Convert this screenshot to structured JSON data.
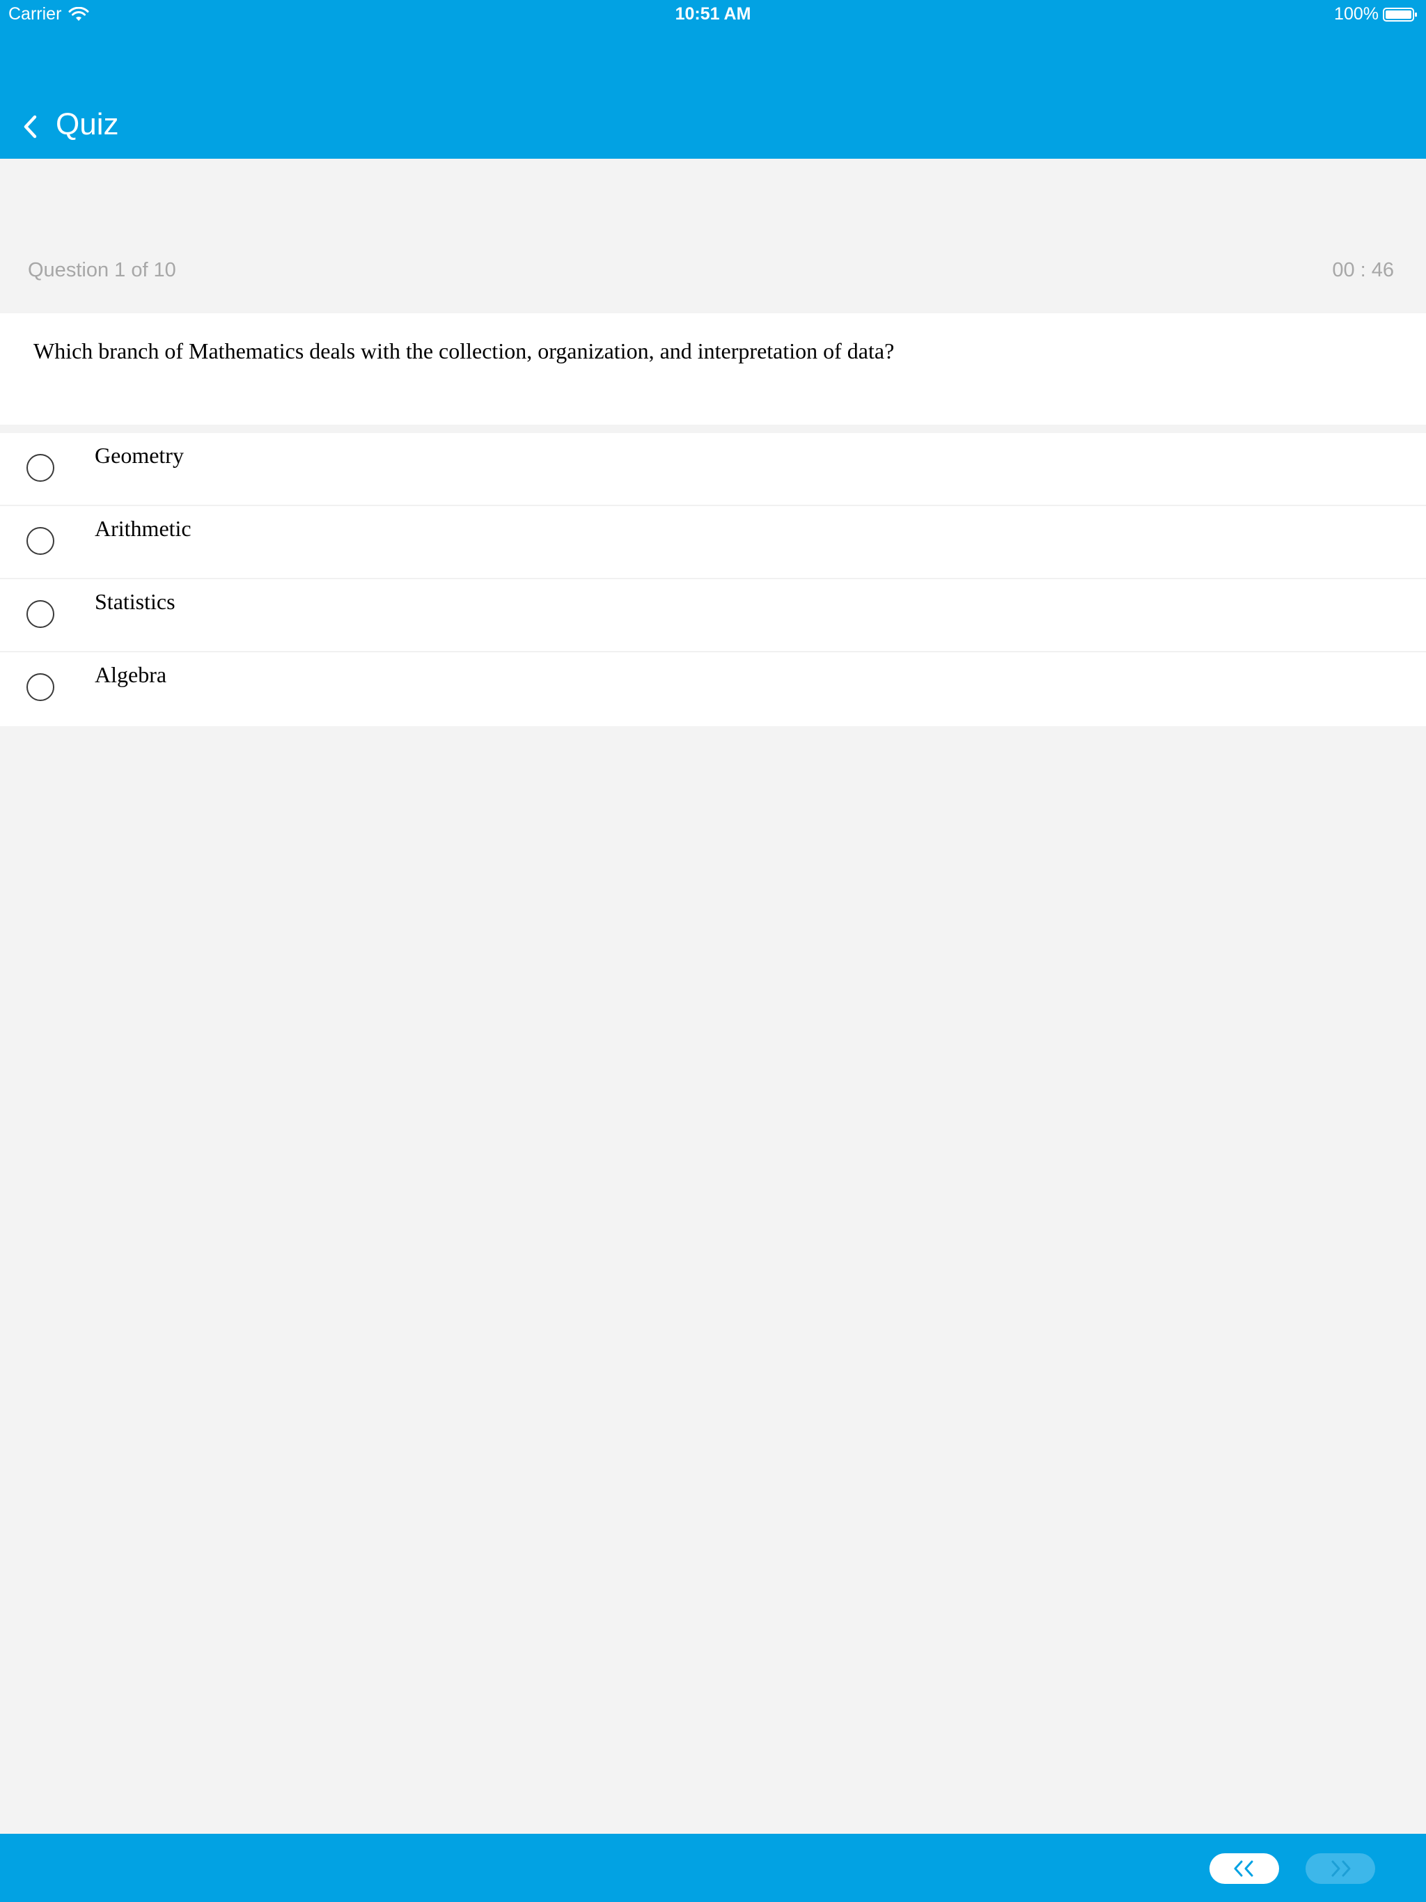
{
  "status_bar": {
    "carrier": "Carrier",
    "time": "10:51 AM",
    "battery": "100%"
  },
  "nav": {
    "title": "Quiz",
    "back_icon": "chevron-left-icon"
  },
  "quiz": {
    "progress": "Question 1 of 10",
    "timer": "00 : 46",
    "question": "Which branch of Mathematics deals with the collection, organization, and interpretation of data?",
    "options": [
      "Geometry",
      "Arithmetic",
      "Statistics",
      "Algebra"
    ]
  },
  "footer": {
    "prev_icon": "double-chevron-left-icon",
    "next_icon": "double-chevron-right-icon"
  },
  "colors": {
    "brand": "#02a2e3",
    "background": "#f3f3f3",
    "muted_text": "#a7a7a7",
    "next_disabled": "#3db7ea"
  }
}
